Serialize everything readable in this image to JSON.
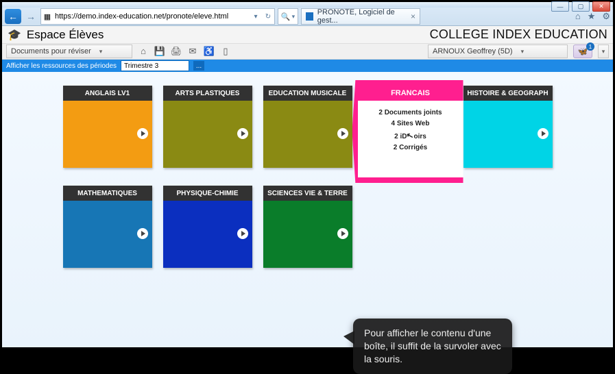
{
  "browser": {
    "url": "https://demo.index-education.net/pronote/eleve.html",
    "tab_title": "PRONOTE, Logiciel de gest...",
    "search_glyph": "🔍"
  },
  "header": {
    "app_title": "Espace Élèves",
    "school_title": "COLLEGE INDEX EDUCATION"
  },
  "toolbar": {
    "documents_label": "Documents pour réviser",
    "user_label": "ARNOUX Geoffrey (5D)",
    "badge_count": "1"
  },
  "filter": {
    "label": "Afficher les ressources des périodes",
    "value": "Trimestre 3",
    "button": "..."
  },
  "tiles": [
    {
      "title": "ANGLAIS LV1",
      "cls": "c-anglais"
    },
    {
      "title": "ARTS PLASTIQUES",
      "cls": "c-arts"
    },
    {
      "title": "EDUCATION MUSICALE",
      "cls": "c-musique"
    },
    {
      "title": "FRANCAIS",
      "cls": "expanded"
    },
    {
      "title": "HISTOIRE & GEOGRAPH",
      "cls": "c-histoire"
    },
    {
      "title": "MATHEMATIQUES",
      "cls": "c-math"
    },
    {
      "title": "PHYSIQUE-CHIMIE",
      "cls": "c-phys"
    },
    {
      "title": "SCIENCES VIE & TERRE",
      "cls": "c-svt"
    }
  ],
  "expanded": {
    "title": "FRANCAIS",
    "lines": [
      "2 Documents joints",
      "4 Sites Web",
      "2 iDevoirs",
      "2 Corrigés"
    ]
  },
  "tooltip": "Pour afficher le contenu d'une boîte, il suffit de la survoler avec la souris."
}
